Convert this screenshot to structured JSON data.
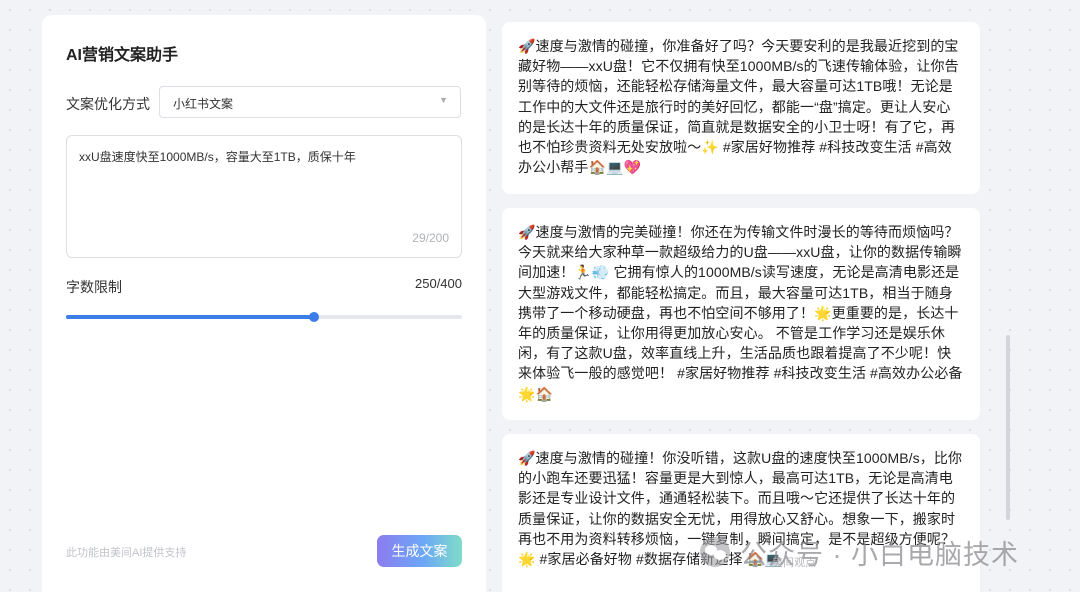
{
  "left_panel": {
    "title": "AI营销文案助手",
    "optimize_label": "文案优化方式",
    "optimize_value": "小红书文案",
    "select_arrow": "▼",
    "input_text": "xxU盘速度快至1000MB/s，容量大至1TB，质保十年",
    "input_count": "29/200",
    "limit_label": "字数限制",
    "limit_value": "250/400",
    "limit_fraction": 0.625,
    "footer_note": "此功能由美间AI提供支持",
    "generate_label": "生成文案"
  },
  "results": [
    "🚀速度与激情的碰撞，你准备好了吗？今天要安利的是我最近挖到的宝藏好物——xxU盘！它不仅拥有快至1000MB/s的飞速传输体验，让你告别等待的烦恼，还能轻松存储海量文件，最大容量可达1TB哦！无论是工作中的大文件还是旅行时的美好回忆，都能一“盘”搞定。更让人安心的是长达十年的质量保证，简直就是数据安全的小卫士呀！有了它，再也不怕珍贵资料无处安放啦～✨ #家居好物推荐 #科技改变生活 #高效办公小帮手🏠💻💖",
    "🚀速度与激情的完美碰撞！你还在为传输文件时漫长的等待而烦恼吗？今天就来给大家种草一款超级给力的U盘——xxU盘，让你的数据传输瞬间加速！🏃💨 它拥有惊人的1000MB/s读写速度，无论是高清电影还是大型游戏文件，都能轻松搞定。而且，最大容量可达1TB，相当于随身携带了一个移动硬盘，再也不怕空间不够用了！🌟更重要的是，长达十年的质量保证，让你用得更加放心安心。 不管是工作学习还是娱乐休闲，有了这款U盘，效率直线上升，生活品质也跟着提高了不少呢！快来体验飞一般的感觉吧！ #家居好物推荐 #科技改变生活 #高效办公必备🌟🏠",
    "🚀速度与激情的碰撞！你没听错，这款U盘的速度快至1000MB/s，比你的小跑车还要迅猛！容量更是大到惊人，最高可达1TB，无论是高清电影还是专业设计文件，通通轻松装下。而且哦～它还提供了长达十年的质量保证，让你的数据安全无忧，用得放心又舒心。想象一下，搬家时再也不用为资料转移烦恼，一键复制，瞬间搞定，是不是超级方便呢？🌟 #家居必备好物 #数据存储新选择 🏠💻"
  ],
  "watermark": {
    "text": "公众号 · 小白电脑技术",
    "sub": "美间观点"
  }
}
